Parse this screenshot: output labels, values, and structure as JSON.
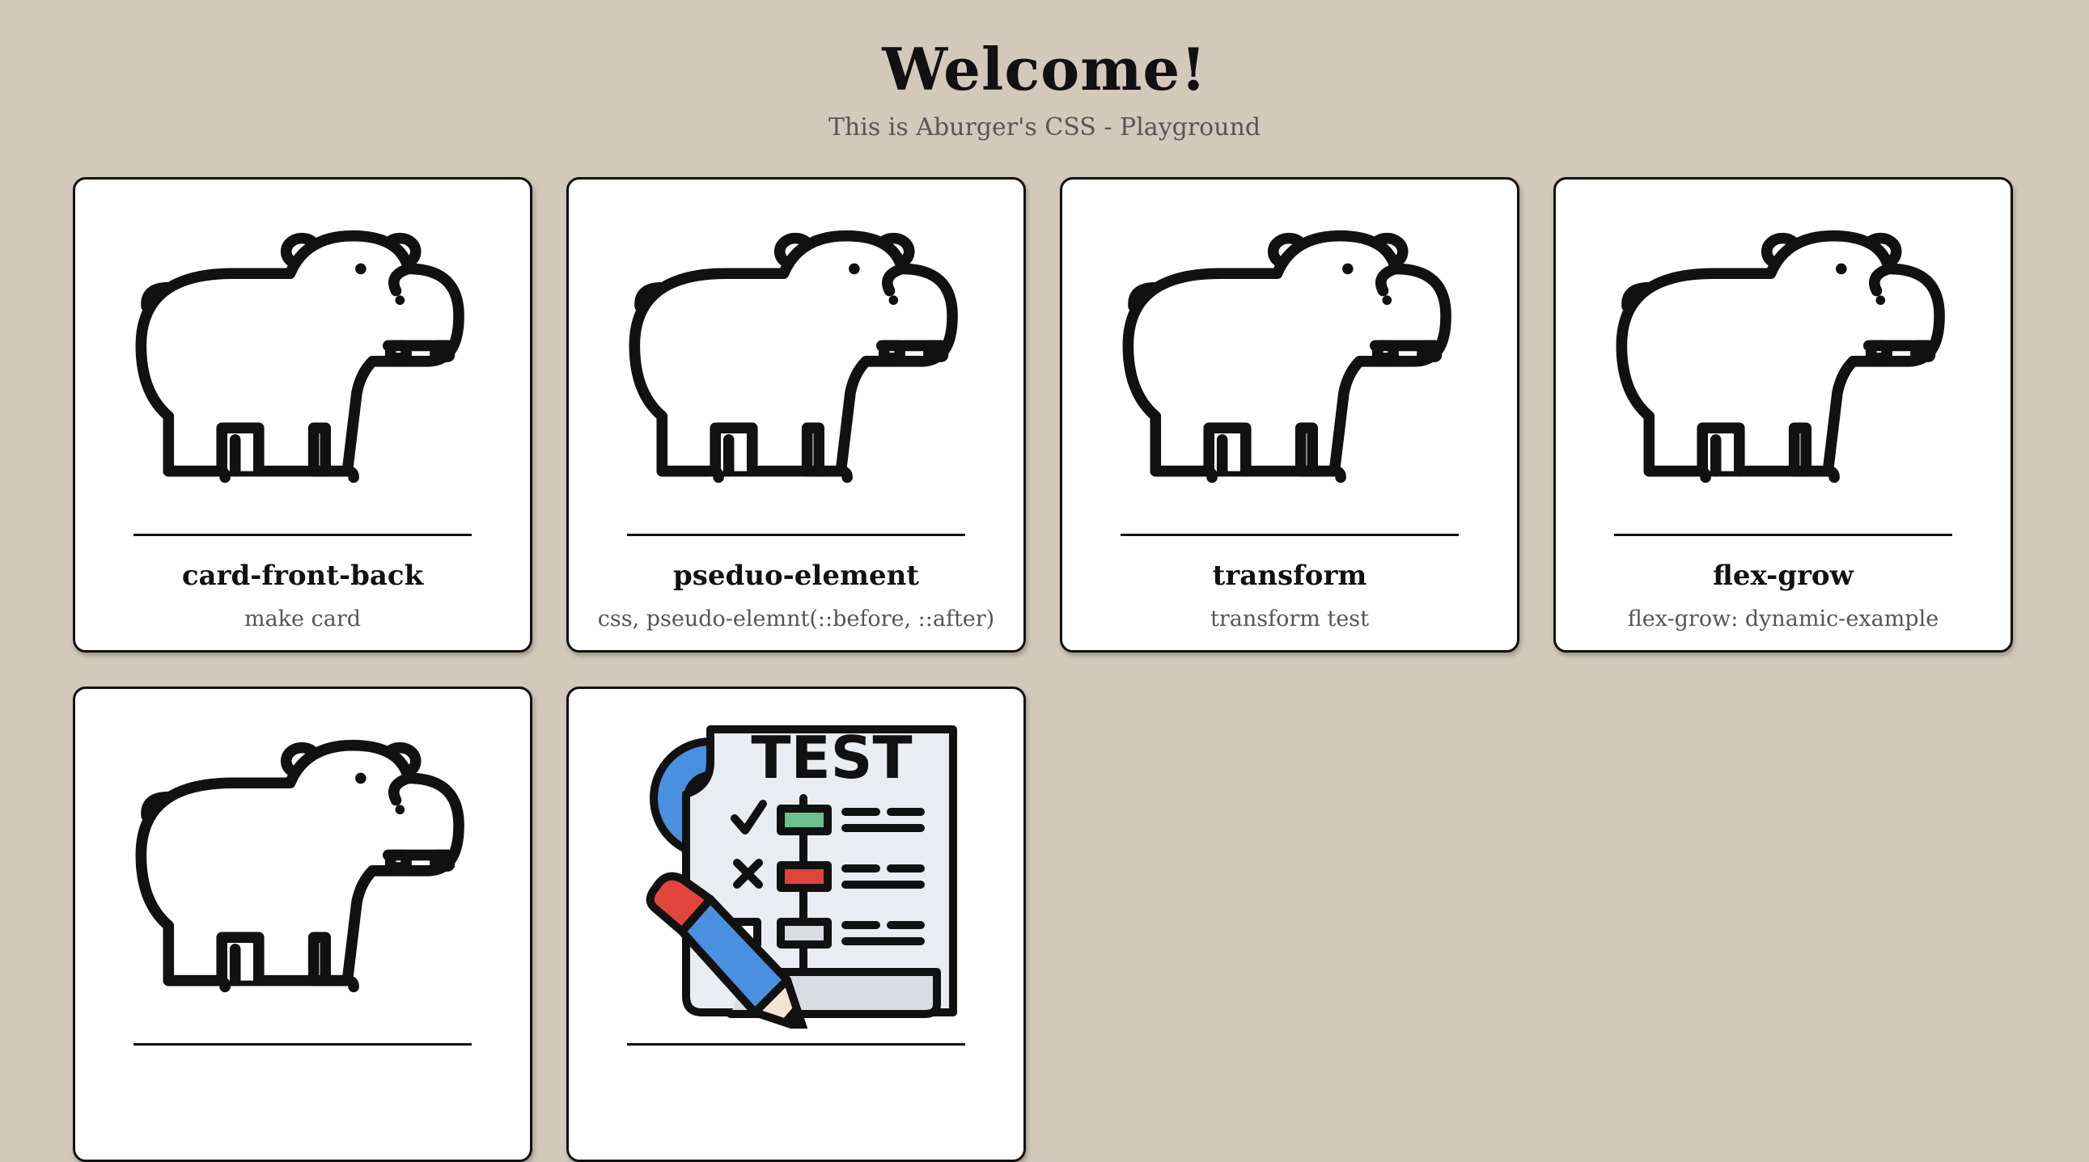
{
  "header": {
    "title": "Welcome!",
    "subtitle": "This is Aburger's CSS - Playground"
  },
  "cards": [
    {
      "title": "card-front-back",
      "description": "make card",
      "icon": "hippo-icon"
    },
    {
      "title": "pseduo-element",
      "description": "css, pseudo-elemnt(::before, ::after)",
      "icon": "hippo-icon"
    },
    {
      "title": "transform",
      "description": "transform test",
      "icon": "hippo-icon"
    },
    {
      "title": "flex-grow",
      "description": "flex-grow: dynamic-example",
      "icon": "hippo-icon"
    },
    {
      "title": "",
      "description": "",
      "icon": "hippo-icon"
    },
    {
      "title": "",
      "description": "",
      "icon": "test-document-icon",
      "icon_text": "TEST"
    }
  ],
  "colors": {
    "background": "#d3c9bb",
    "card": "#ffffff",
    "gear": "#4a8fe0",
    "check_box": "#6cc08b",
    "cross_box": "#e0453c",
    "pencil_body": "#4a8fe0",
    "pencil_eraser": "#e0453c",
    "paper": "#e9edf1"
  }
}
